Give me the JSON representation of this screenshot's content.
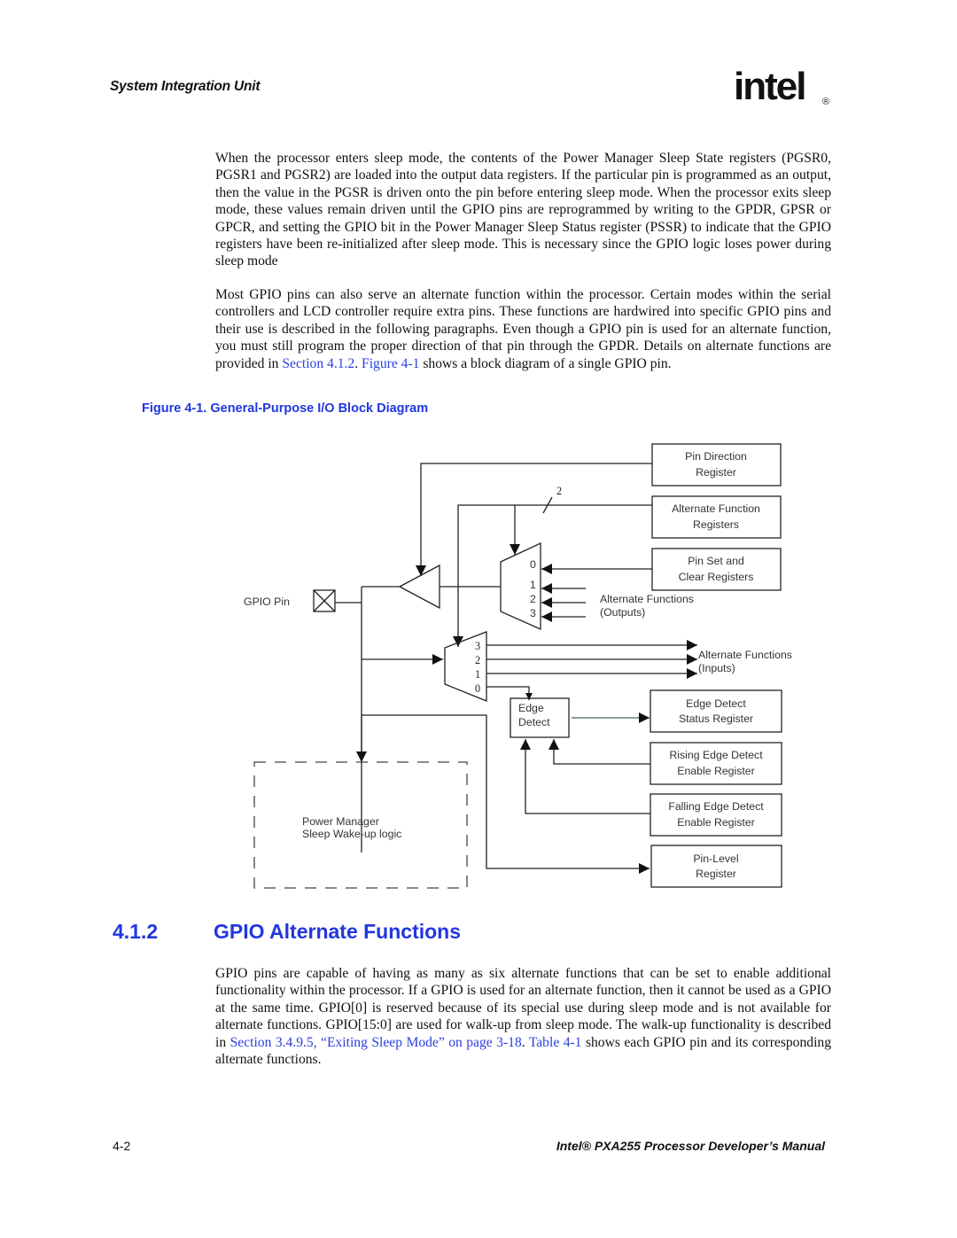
{
  "header": {
    "section_title": "System Integration Unit",
    "logo_text": "intel",
    "logo_mark": "®"
  },
  "paragraph1": "When the processor enters sleep mode, the contents of the Power Manager Sleep State registers (PGSR0, PGSR1 and PGSR2) are loaded into the output data registers. If the particular pin is programmed as an output, then the value in the PGSR is driven onto the pin before entering sleep mode. When the processor exits sleep mode, these values remain driven until the GPIO pins are reprogrammed by writing to the GPDR, GPSR or GPCR, and setting the GPIO bit in the Power Manager Sleep Status register (PSSR) to indicate that the GPIO registers have been re-initialized after sleep mode. This is necessary since the GPIO logic loses power during sleep mode",
  "paragraph2": {
    "text_before": "Most GPIO pins can also serve an alternate function within the processor. Certain modes within the serial controllers and LCD controller require extra pins. These functions are hardwired into specific GPIO pins and their use is described in the following paragraphs. Even though a GPIO pin is used for an alternate function, you must still program the proper direction of that pin through the GPDR. Details on alternate functions are provided in ",
    "link1": "Section 4.1.2",
    "text_mid": ". ",
    "link2": "Figure 4-1",
    "text_after": " shows a block diagram of a single GPIO pin."
  },
  "figure": {
    "caption": "Figure 4-1. General-Purpose I/O Block Diagram",
    "labels": {
      "gpio_pin": "GPIO Pin",
      "pin_direction": [
        "Pin Direction",
        "Register"
      ],
      "alt_function_regs": [
        "Alternate Function",
        "Registers"
      ],
      "bus_width": "2",
      "pin_set_clear": [
        "Pin Set and",
        "Clear Registers"
      ],
      "alt_outputs": [
        "Alternate Functions",
        "(Outputs)"
      ],
      "alt_inputs": [
        "Alternate Functions",
        "(Inputs)"
      ],
      "edge_detect": [
        "Edge",
        "Detect"
      ],
      "edge_status": [
        "Edge Detect",
        "Status Register"
      ],
      "rising_enable": [
        "Rising Edge Detect",
        "Enable Register"
      ],
      "falling_enable": [
        "Falling Edge Detect",
        "Enable Register"
      ],
      "pin_level": [
        "Pin-Level",
        "Register"
      ],
      "power_manager": [
        "Power Manager",
        "Sleep Wake-up logic"
      ],
      "out_mux_inputs": [
        "0",
        "1",
        "2",
        "3"
      ],
      "in_mux_outputs": [
        "3",
        "2",
        "1",
        "0"
      ]
    }
  },
  "section": {
    "number": "4.1.2",
    "title": "GPIO Alternate Functions"
  },
  "paragraph3": {
    "text_before": "GPIO pins are capable of having as many as six alternate functions that can be set to enable additional functionality within the processor. If a GPIO is used for an alternate function, then it cannot be used as a GPIO at the same time. GPIO[0] is reserved because of its special use during sleep mode and is not available for alternate functions. GPIO[15:0] are used for walk-up from sleep mode. The walk-up functionality is described in ",
    "link1": "Section 3.4.9.5, “Exiting Sleep Mode” on page 3-18",
    "text_mid": ". ",
    "link2": "Table 4-1",
    "text_after": " shows each GPIO pin and its corresponding alternate functions."
  },
  "footer": {
    "page_number": "4-2",
    "manual_title": "Intel® PXA255 Processor Developer’s Manual"
  },
  "colors": {
    "link": "#2a3fe0",
    "heading": "#2236e0",
    "text": "#111111"
  }
}
